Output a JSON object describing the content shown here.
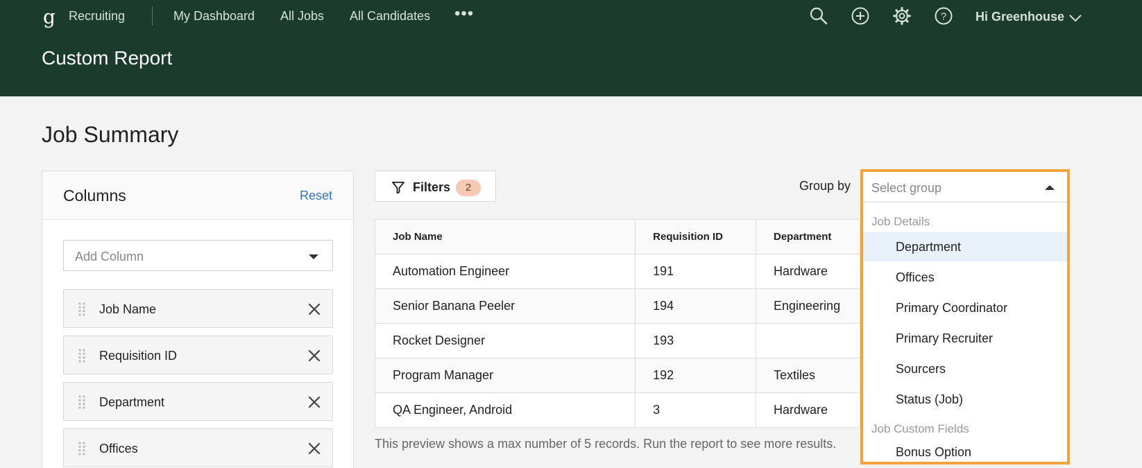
{
  "header": {
    "logo": "g",
    "app_name": "Recruiting",
    "nav": [
      "My Dashboard",
      "All Jobs",
      "All Candidates"
    ],
    "more": "•••",
    "icons": [
      "search-icon",
      "add-circle-icon",
      "gear-icon",
      "help-icon"
    ],
    "greeting": "Hi Greenhouse",
    "page_title": "Custom Report"
  },
  "section_title": "Job Summary",
  "columns_panel": {
    "title": "Columns",
    "reset": "Reset",
    "add_placeholder": "Add Column",
    "items": [
      "Job Name",
      "Requisition ID",
      "Department",
      "Offices"
    ]
  },
  "filters": {
    "label": "Filters",
    "count": "2"
  },
  "group_by": {
    "label": "Group by",
    "placeholder": "Select group",
    "groups": [
      {
        "heading": "Job Details",
        "options": [
          "Department",
          "Offices",
          "Primary Coordinator",
          "Primary Recruiter",
          "Sourcers",
          "Status (Job)"
        ]
      },
      {
        "heading": "Job Custom Fields",
        "options": [
          "Bonus Option"
        ]
      }
    ],
    "highlighted": "Department",
    "accent_color": "#f4a23a"
  },
  "table": {
    "headers": [
      "Job Name",
      "Requisition ID",
      "Department"
    ],
    "rows": [
      [
        "Automation Engineer",
        "191",
        "Hardware"
      ],
      [
        "Senior Banana Peeler",
        "194",
        "Engineering"
      ],
      [
        "Rocket Designer",
        "193",
        ""
      ],
      [
        "Program Manager",
        "192",
        "Textiles"
      ],
      [
        "QA Engineer, Android",
        "3",
        "Hardware"
      ]
    ]
  },
  "preview_note": "This preview shows a max number of 5 records. Run the report to see more results."
}
